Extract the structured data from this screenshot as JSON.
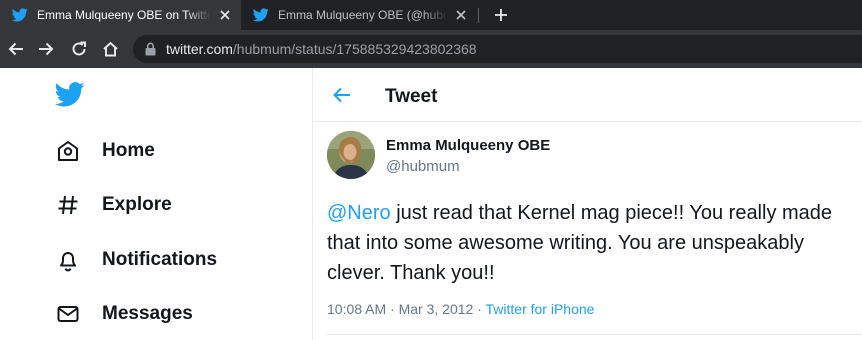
{
  "browser": {
    "tabs": [
      {
        "title": "Emma Mulqueeny OBE on Twitter: \"@Nero just read that Kernel mag piece!!\"",
        "favicon": "twitter-bird-icon",
        "active": true
      },
      {
        "title": "Emma Mulqueeny OBE (@hubmum) / Twitter",
        "favicon": "twitter-bird-icon",
        "active": false
      }
    ],
    "url": {
      "host": "twitter.com",
      "path": "/hubmum/status/175885329423802368"
    }
  },
  "sidebar": {
    "logo": "twitter-bird-icon",
    "items": [
      {
        "label": "Home",
        "icon": "home-icon"
      },
      {
        "label": "Explore",
        "icon": "hashtag-icon"
      },
      {
        "label": "Notifications",
        "icon": "bell-icon"
      },
      {
        "label": "Messages",
        "icon": "envelope-icon"
      }
    ]
  },
  "header": {
    "title": "Tweet"
  },
  "tweet": {
    "display_name": "Emma Mulqueeny OBE",
    "handle": "@hubmum",
    "mention": "@Nero",
    "text": " just read that Kernel mag piece!! You really made that into some awesome writing. You are unspeakably clever. Thank you!!",
    "timestamp": "10:08 AM · Mar 3, 2012 · ",
    "source": "Twitter for iPhone"
  },
  "colors": {
    "twitter_blue": "#1da1f2",
    "text_primary": "#14171a",
    "text_secondary": "#657786",
    "chrome_dark": "#202124",
    "chrome_toolbar": "#35363a"
  }
}
